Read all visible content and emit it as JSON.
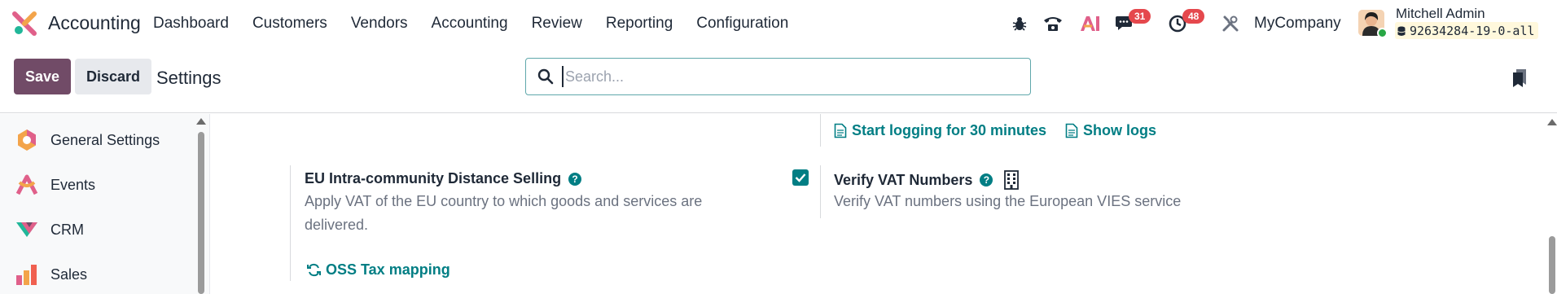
{
  "app": {
    "name": "Accounting"
  },
  "menu": [
    {
      "label": "Dashboard"
    },
    {
      "label": "Customers"
    },
    {
      "label": "Vendors"
    },
    {
      "label": "Accounting"
    },
    {
      "label": "Review"
    },
    {
      "label": "Reporting"
    },
    {
      "label": "Configuration"
    }
  ],
  "systray": {
    "messages_count": "31",
    "activities_count": "48",
    "company": "MyCompany",
    "user_name": "Mitchell Admin",
    "database": "92634284-19-0-all"
  },
  "control_panel": {
    "save_label": "Save",
    "discard_label": "Discard",
    "breadcrumb": "Settings",
    "search_placeholder": "Search..."
  },
  "sidebar": {
    "items": [
      {
        "label": "General Settings",
        "icon": "general-settings-icon"
      },
      {
        "label": "Events",
        "icon": "events-icon"
      },
      {
        "label": "CRM",
        "icon": "crm-icon"
      },
      {
        "label": "Sales",
        "icon": "sales-icon"
      }
    ]
  },
  "settings": {
    "logging_link": "Start logging for 30 minutes",
    "show_logs_link": "Show logs",
    "eu_distance_selling": {
      "title": "EU Intra-community Distance Selling",
      "description": "Apply VAT of the EU country to which goods and services are delivered.",
      "action": "OSS Tax mapping",
      "checked": true
    },
    "verify_vat": {
      "title": "Verify VAT Numbers",
      "description": "Verify VAT numbers using the European VIES service"
    }
  },
  "colors": {
    "primary": "#714b67",
    "link": "#017e84",
    "badge": "#e5484d"
  }
}
